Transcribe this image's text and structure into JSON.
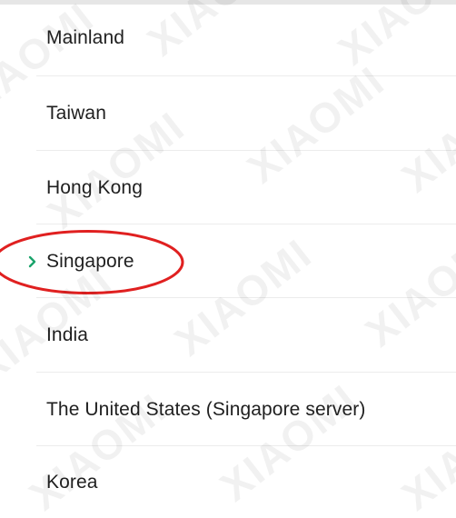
{
  "regions": {
    "items": [
      {
        "label": "Mainland",
        "selected": false
      },
      {
        "label": "Taiwan",
        "selected": false
      },
      {
        "label": "Hong Kong",
        "selected": false
      },
      {
        "label": "Singapore",
        "selected": true
      },
      {
        "label": "India",
        "selected": false
      },
      {
        "label": "The United States (Singapore server)",
        "selected": false
      },
      {
        "label": "Korea",
        "selected": false
      }
    ]
  },
  "selection_indicator": {
    "icon": "chevron-right-icon",
    "color": "#1aa36b"
  },
  "annotation": {
    "shape": "ellipse",
    "color": "#e02020",
    "target": "Singapore"
  },
  "watermark": {
    "text": "XIAOMI"
  }
}
